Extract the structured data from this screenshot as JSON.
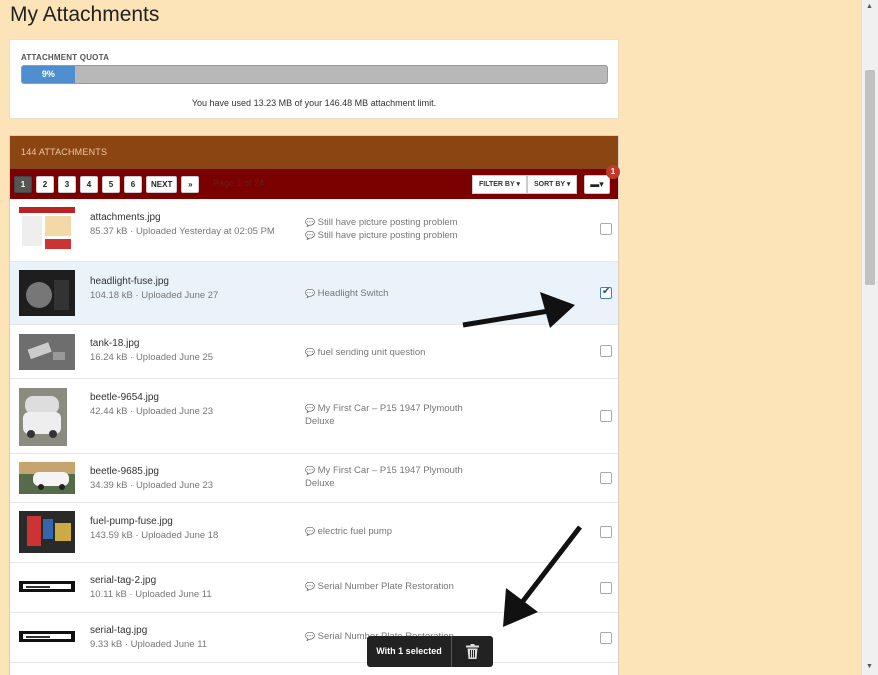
{
  "page": {
    "title": "My Attachments"
  },
  "quota": {
    "label": "ATTACHMENT QUOTA",
    "percent": 9,
    "percent_label": "9%",
    "text": "You have used 13.23 MB of your 146.48 MB attachment limit."
  },
  "list": {
    "header": "144 ATTACHMENTS",
    "pages": [
      "1",
      "2",
      "3",
      "4",
      "5",
      "6"
    ],
    "active_page": "1",
    "next_label": "NEXT",
    "last_label": "»",
    "page_of": "Page 1 of 24",
    "filter_label": "FILTER BY ▾",
    "sort_label": "SORT BY ▾",
    "notification_count": "1"
  },
  "attachments": [
    {
      "name": "attachments.jpg",
      "meta": "85.37 kB · Uploaded Yesterday at 02:05 PM",
      "threads": [
        "Still have picture posting problem",
        "Still have picture posting problem"
      ],
      "checked": false,
      "thumb": "screenshot"
    },
    {
      "name": "headlight-fuse.jpg",
      "meta": "104.18 kB · Uploaded June 27",
      "threads": [
        "Headlight Switch"
      ],
      "checked": true,
      "thumb": "dark-photo"
    },
    {
      "name": "tank-18.jpg",
      "meta": "16.24 kB · Uploaded June 25",
      "threads": [
        "fuel sending unit question"
      ],
      "checked": false,
      "thumb": "gray-photo"
    },
    {
      "name": "beetle-9654.jpg",
      "meta": "42.44 kB · Uploaded June 23",
      "threads": [
        "My First Car – P15 1947 Plymouth Deluxe"
      ],
      "checked": false,
      "thumb": "car-photo"
    },
    {
      "name": "beetle-9685.jpg",
      "meta": "34.39 kB · Uploaded June 23",
      "threads": [
        "My First Car – P15 1947 Plymouth Deluxe"
      ],
      "checked": false,
      "thumb": "car-outdoor"
    },
    {
      "name": "fuel-pump-fuse.jpg",
      "meta": "143.59 kB · Uploaded June 18",
      "threads": [
        "electric fuel pump"
      ],
      "checked": false,
      "thumb": "wires-photo"
    },
    {
      "name": "serial-tag-2.jpg",
      "meta": "10.11 kB · Uploaded June 11",
      "threads": [
        "Serial Number Plate Restoration"
      ],
      "checked": false,
      "thumb": "serial-tag"
    },
    {
      "name": "serial-tag.jpg",
      "meta": "9.33 kB · Uploaded June 11",
      "threads": [
        "Serial Number Plate Restoration"
      ],
      "checked": false,
      "thumb": "serial-tag"
    }
  ],
  "selection": {
    "label": "With 1 selected",
    "icon": "trash-icon"
  },
  "colors": {
    "background": "#fde4b8",
    "header": "#8b4513",
    "toolbar": "#7b0000",
    "quota_fill": "#4f8fcf"
  }
}
